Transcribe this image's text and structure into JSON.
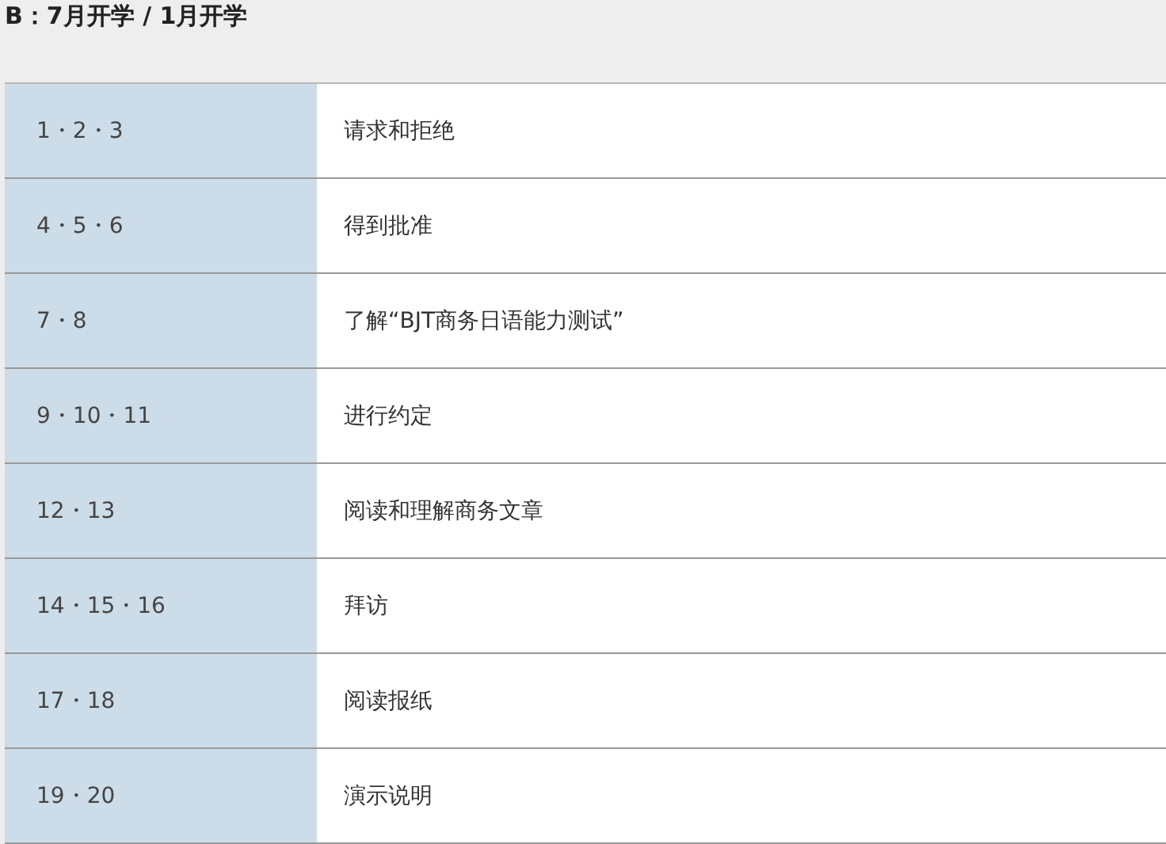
{
  "heading": "B：7月开学 / 1月开学",
  "table": {
    "rows": [
      {
        "units": "1・2・3",
        "topic": "请求和拒绝"
      },
      {
        "units": "4・5・6",
        "topic": "得到批准"
      },
      {
        "units": "7・8",
        "topic": "了解“BJT商务日语能力测试”"
      },
      {
        "units": "9・10・11",
        "topic": "进行约定"
      },
      {
        "units": "12・13",
        "topic": "阅读和理解商务文章"
      },
      {
        "units": "14・15・16",
        "topic": "拜访"
      },
      {
        "units": "17・18",
        "topic": "阅读报纸"
      },
      {
        "units": "19・20",
        "topic": "演示说明"
      }
    ]
  }
}
